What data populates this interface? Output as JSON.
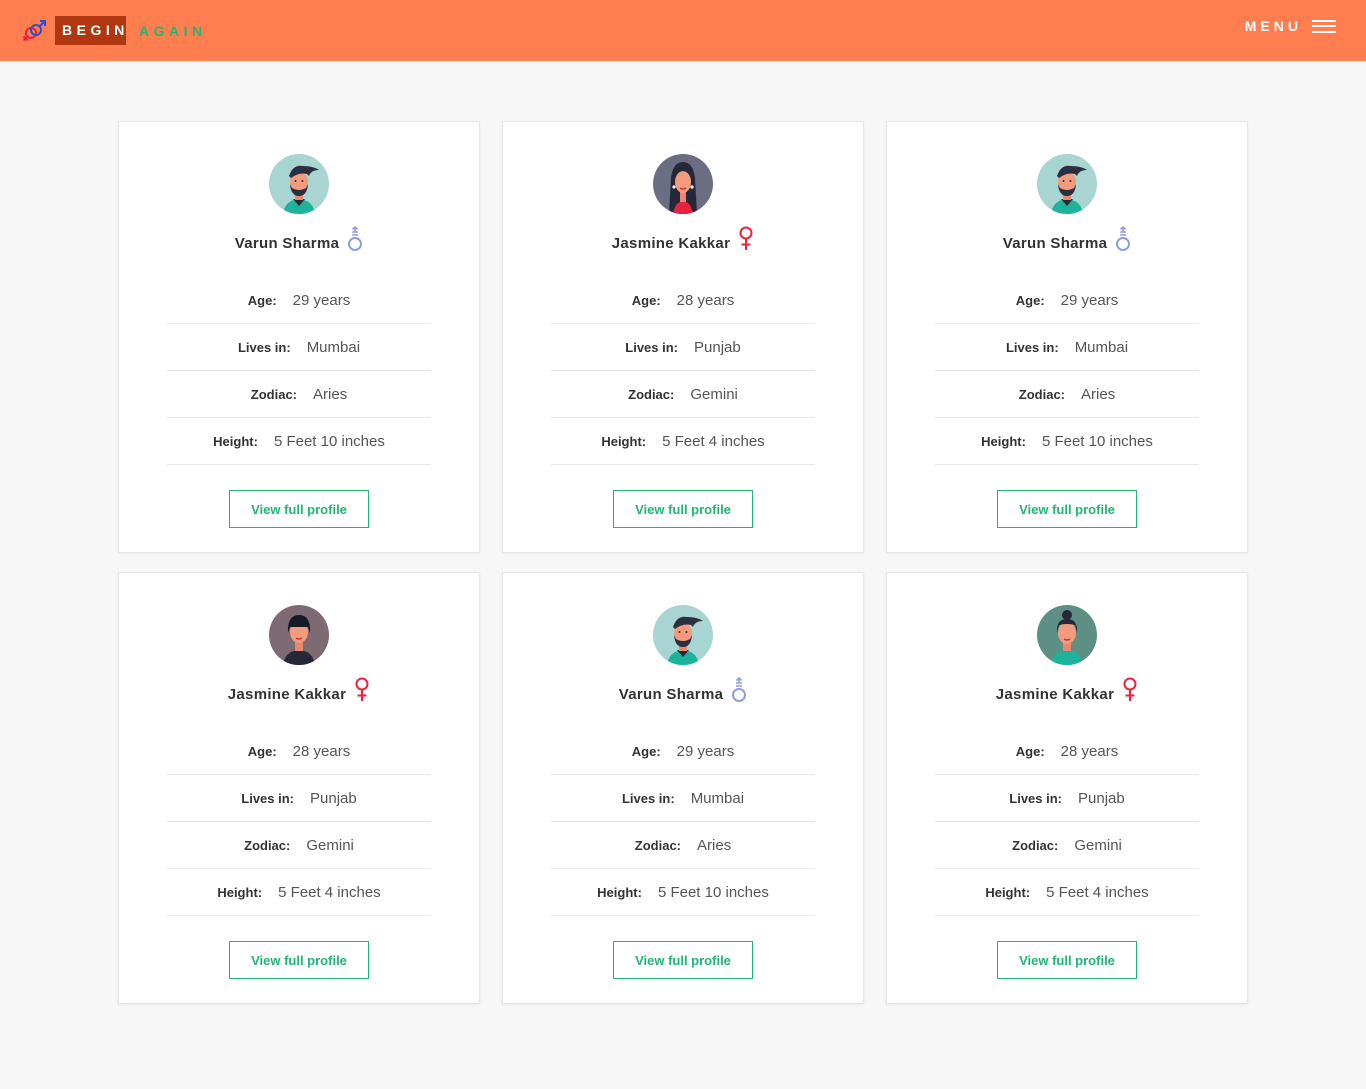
{
  "header": {
    "logo_word_1": "BEGIN",
    "logo_word_2": "AGAIN",
    "menu_label": "MENU",
    "background_color": "#ff7e4f"
  },
  "labels": {
    "age": "Age:",
    "lives_in": "Lives in:",
    "zodiac": "Zodiac:",
    "height": "Height:"
  },
  "profiles": [
    {
      "name": "Varun Sharma",
      "gender": "male",
      "age": "29 years",
      "lives_in": "Mumbai",
      "zodiac": "Aries",
      "height": "5 Feet 10 inches",
      "button": "View full profile"
    },
    {
      "name": "Jasmine Kakkar",
      "gender": "female",
      "age": "28 years",
      "lives_in": "Punjab",
      "zodiac": "Gemini",
      "height": "5 Feet 4 inches",
      "button": "View full profile"
    },
    {
      "name": "Varun Sharma",
      "gender": "male",
      "age": "29 years",
      "lives_in": "Mumbai",
      "zodiac": "Aries",
      "height": "5 Feet 10 inches",
      "button": "View full profile"
    },
    {
      "name": "Jasmine Kakkar",
      "gender": "female",
      "age": "28 years",
      "lives_in": "Punjab",
      "zodiac": "Gemini",
      "height": "5 Feet 4 inches",
      "button": "View full profile"
    },
    {
      "name": "Varun Sharma",
      "gender": "male",
      "age": "29 years",
      "lives_in": "Mumbai",
      "zodiac": "Aries",
      "height": "5 Feet 10 inches",
      "button": "View full profile"
    },
    {
      "name": "Jasmine Kakkar",
      "gender": "female",
      "age": "28 years",
      "lives_in": "Punjab",
      "zodiac": "Gemini",
      "height": "5 Feet 4 inches",
      "button": "View full profile"
    }
  ],
  "colors": {
    "accent_green": "#21b573",
    "male_icon": "#8b9fe0",
    "female_icon": "#e8243c"
  }
}
